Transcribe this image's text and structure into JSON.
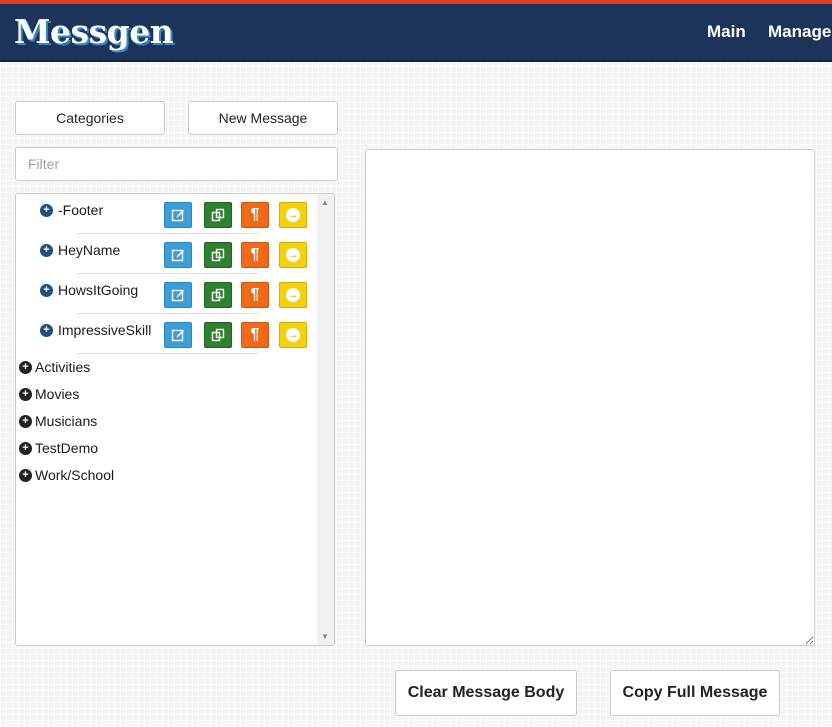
{
  "app": {
    "title": "Messgen",
    "nav": [
      {
        "label": "Main"
      },
      {
        "label": "Manage"
      }
    ]
  },
  "toolbar": {
    "categories_label": "Categories",
    "new_message_label": "New Message"
  },
  "filter": {
    "placeholder": "Filter",
    "value": ""
  },
  "tree": {
    "messages": [
      {
        "label": "-Footer"
      },
      {
        "label": "HeyName"
      },
      {
        "label": "HowsItGoing"
      },
      {
        "label": "ImpressiveSkill"
      }
    ],
    "message_actions": {
      "edit_icon": "edit-icon",
      "copy_icon": "copy-icon",
      "paragraph_icon": "¶",
      "go_icon": "arrow-right-icon"
    },
    "categories": [
      {
        "label": "Activities"
      },
      {
        "label": "Movies"
      },
      {
        "label": "Musicians"
      },
      {
        "label": "TestDemo"
      },
      {
        "label": "Work/School"
      }
    ]
  },
  "message_body": {
    "value": ""
  },
  "actions": {
    "clear_label": "Clear Message Body",
    "copy_label": "Copy Full Message"
  },
  "colors": {
    "navbar": "#1c3459",
    "accent": "#e8391f",
    "edit": "#3a9fd6",
    "copy": "#2f8030",
    "paragraph": "#f06a17",
    "go": "#f4d10c"
  }
}
